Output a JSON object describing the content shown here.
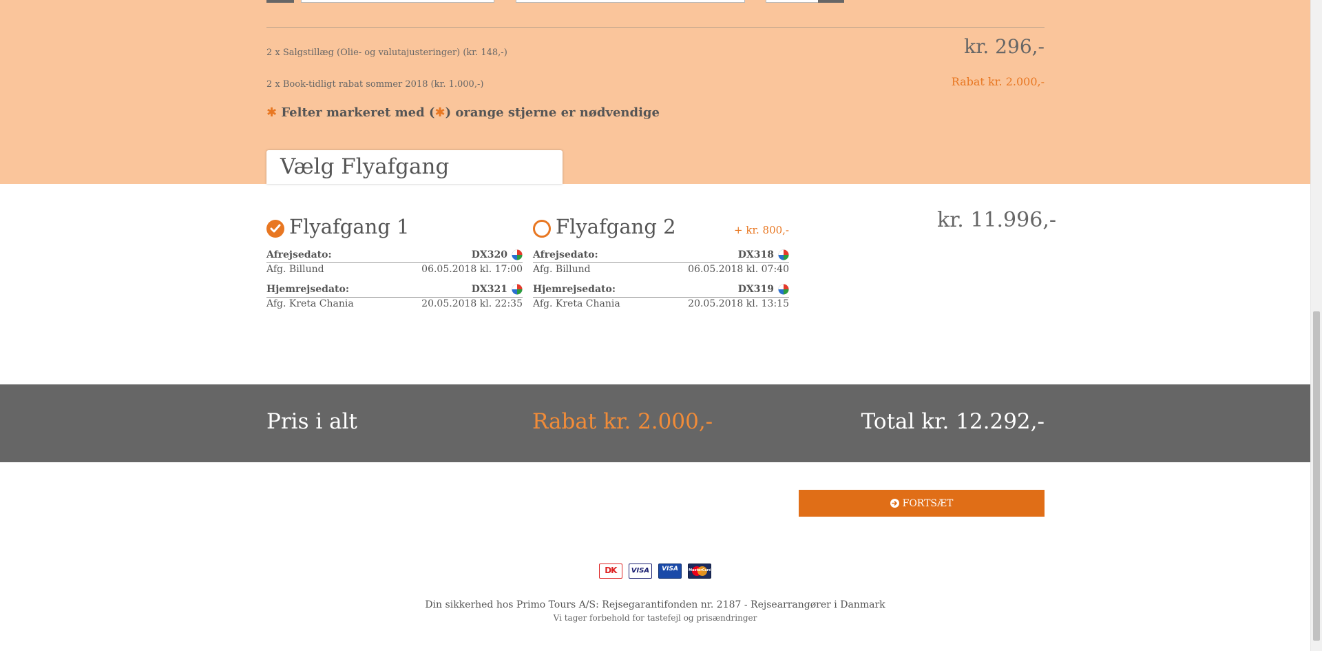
{
  "fees": {
    "sales_surcharge_label": "2 x Salgstillæg (Olie- og valutajusteringer) (kr. 148,-)",
    "sales_surcharge_price": "kr. 296,-",
    "early_booking_label": "2 x Book-tidligt rabat sommer 2018 (kr. 1.000,-)",
    "early_booking_discount": "Rabat kr. 2.000,-"
  },
  "required_note": {
    "star": "✱",
    "text_before": "Felter markeret med (",
    "text_after": ") orange stjerne er nødvendige"
  },
  "flight_section": {
    "tab_title": "Vælg Flyafgang",
    "current_price": "kr. 11.996,-"
  },
  "flights": [
    {
      "title": "Flyafgang 1",
      "selected": true,
      "extra_price": "",
      "outbound": {
        "label": "Afrejsedato:",
        "code": "DX320",
        "from": "Afg. Billund",
        "datetime": "06.05.2018 kl. 17:00"
      },
      "return": {
        "label": "Hjemrejsedato:",
        "code": "DX321",
        "from": "Afg. Kreta Chania",
        "datetime": "20.05.2018 kl. 22:35"
      }
    },
    {
      "title": "Flyafgang 2",
      "selected": false,
      "extra_price": "+ kr. 800,-",
      "outbound": {
        "label": "Afrejsedato:",
        "code": "DX318",
        "from": "Afg. Billund",
        "datetime": "06.05.2018 kl. 07:40"
      },
      "return": {
        "label": "Hjemrejsedato:",
        "code": "DX319",
        "from": "Afg. Kreta Chania",
        "datetime": "20.05.2018 kl. 13:15"
      }
    }
  ],
  "summary": {
    "label": "Pris i alt",
    "discount": "Rabat kr. 2.000,-",
    "total": "Total kr. 12.292,-"
  },
  "continue_button": {
    "label": "FORTSÆT",
    "icon": "arrow-circle-right-icon"
  },
  "payment_cards": [
    {
      "name": "dankort-icon",
      "text": "DK"
    },
    {
      "name": "visa-icon",
      "text": "VISA"
    },
    {
      "name": "visa-electron-icon",
      "text": "VISA"
    },
    {
      "name": "mastercard-icon",
      "text": "MasterCard"
    }
  ],
  "footer": {
    "security_text": "Din sikkerhed hos Primo Tours A/S: Rejsegarantifonden nr. 2187 - Rejsearrangører i Danmark",
    "disclaimer": "Vi tager forbehold for tastefejl og prisændringer"
  },
  "colors": {
    "accent": "#e87722",
    "peach_bg": "#fac59b",
    "summary_bar": "#666666",
    "button": "#e06e17"
  }
}
